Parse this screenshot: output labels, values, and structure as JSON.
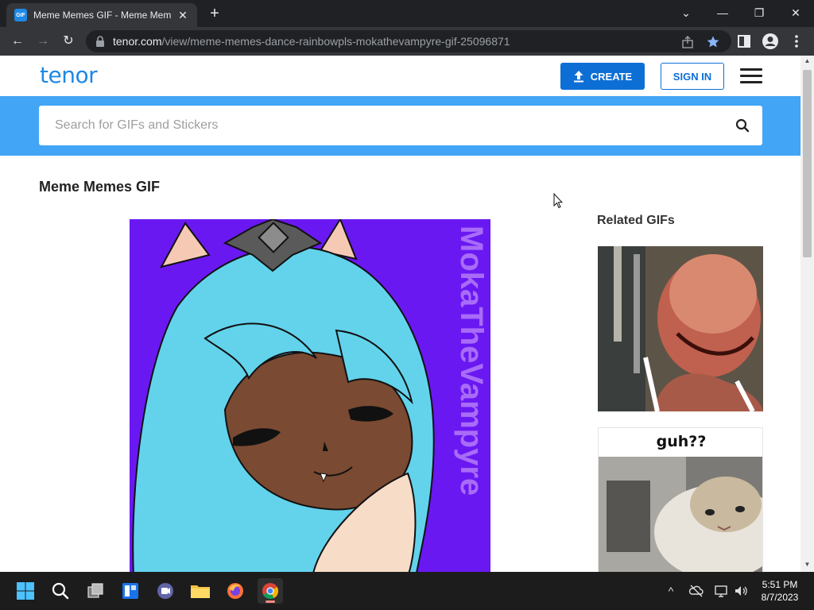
{
  "browser": {
    "tab": {
      "favicon_text": "GIF",
      "title": "Meme Memes GIF - Meme Mem",
      "close_label": "✕"
    },
    "new_tab_label": "+",
    "window_controls": {
      "tab_search": "⌄",
      "minimize": "—",
      "restore": "❐",
      "close": "✕"
    },
    "nav": {
      "back": "←",
      "forward": "→",
      "reload": "↻"
    },
    "url_host": "tenor.com",
    "url_path": "/view/meme-memes-dance-rainbowpls-mokathevampyre-gif-25096871"
  },
  "site": {
    "logo": "tenor",
    "create_label": "CREATE",
    "signin_label": "SIGN IN",
    "search_placeholder": "Search for GIFs and Stickers"
  },
  "main": {
    "title": "Meme Memes GIF",
    "gif_watermark": "MokaTheVampyre",
    "gif_bg": "#6a18f2"
  },
  "related": {
    "title": "Related GIFs",
    "items": [
      {
        "caption": ""
      },
      {
        "caption": "guh??"
      }
    ]
  },
  "taskbar": {
    "clock_time": "5:51 PM",
    "clock_date": "8/7/2023"
  },
  "colors": {
    "accent": "#1e88e5",
    "create_bg": "#0d6fd6",
    "search_band": "#42a5f5"
  }
}
